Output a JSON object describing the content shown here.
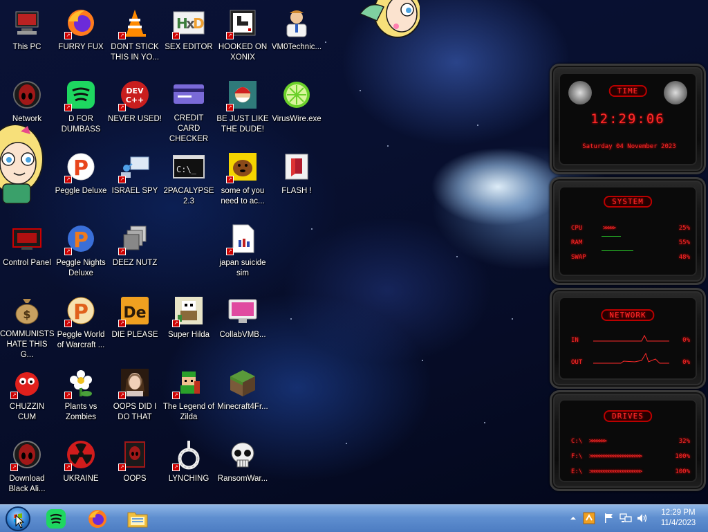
{
  "desktop": {
    "icons": [
      {
        "label": "This PC",
        "icon": "computer-icon"
      },
      {
        "label": "FURRY FUX",
        "icon": "firefox-icon"
      },
      {
        "label": "DONT STICK THIS IN YO...",
        "icon": "vlc-cone-icon"
      },
      {
        "label": "SEX EDITOR",
        "icon": "hex-editor-icon"
      },
      {
        "label": "HOOKED ON XONIX",
        "icon": "xonix-game-icon"
      },
      {
        "label": "VM0Technic...",
        "icon": "technician-icon"
      },
      {
        "label": "Network",
        "icon": "network-alien-icon"
      },
      {
        "label": "D FOR DUMBASS",
        "icon": "spotify-green-icon"
      },
      {
        "label": "NEVER USED!",
        "icon": "devcpp-icon"
      },
      {
        "label": "CREDIT CARD CHECKER",
        "icon": "credit-card-icon"
      },
      {
        "label": "BE JUST LIKE THE DUDE!",
        "icon": "santa-dude-icon"
      },
      {
        "label": "VirusWire.exe",
        "icon": "lime-icon"
      },
      {
        "label": "Peggle Deluxe",
        "icon": "peggle-icon"
      },
      {
        "label": "ISRAEL SPY",
        "icon": "remote-desktop-icon"
      },
      {
        "label": "2PACALYPSE 2.3",
        "icon": "cmd-terminal-icon"
      },
      {
        "label": "some of you need to ac...",
        "icon": "dog-icon"
      },
      {
        "label": "FLASH !",
        "icon": "flash-icon"
      },
      {
        "label": "Control Panel",
        "icon": "control-panel-icon"
      },
      {
        "label": "Peggle Nights Deluxe",
        "icon": "peggle-nights-icon"
      },
      {
        "label": "DEEZ NUTZ",
        "icon": "stacked-windows-icon"
      },
      {
        "label": "japan suicide sim",
        "icon": "document-icon"
      },
      {
        "label": "COMMUNISTS HATE THIS G...",
        "icon": "money-bag-icon"
      },
      {
        "label": "Peggle World of Warcraft ...",
        "icon": "peggle-wow-icon"
      },
      {
        "label": "DIE PLEASE",
        "icon": "de-icon"
      },
      {
        "label": "Super Hilda",
        "icon": "pixel-hilda-icon"
      },
      {
        "label": "CollabVMB...",
        "icon": "collabvm-monitor-icon"
      },
      {
        "label": "CHUZZIN CUM",
        "icon": "chuzzle-icon"
      },
      {
        "label": "Plants vs Zombies",
        "icon": "pvz-flower-icon"
      },
      {
        "label": "OOPS DID I DO THAT",
        "icon": "portrait-icon"
      },
      {
        "label": "The Legend of Zilda",
        "icon": "zilda-icon"
      },
      {
        "label": "Minecraft4Fr...",
        "icon": "minecraft-grass-icon"
      },
      {
        "label": "Download Black Ali...",
        "icon": "alien-head-icon"
      },
      {
        "label": "UKRAINE",
        "icon": "radiation-icon"
      },
      {
        "label": "OOPS",
        "icon": "oops-alien-icon"
      },
      {
        "label": "LYNCHING",
        "icon": "rope-icon"
      },
      {
        "label": "RansomWar...",
        "icon": "skull-icon"
      }
    ]
  },
  "widget": {
    "time": {
      "title": "TIME",
      "clock": "12:29:06",
      "date": "Saturday 04 November 2023"
    },
    "system": {
      "title": "SYSTEM",
      "rows": [
        {
          "label": "CPU",
          "value": "25%",
          "bar": ">>>>>"
        },
        {
          "label": "RAM",
          "value": "55%",
          "bar": ""
        },
        {
          "label": "SWAP",
          "value": "48%",
          "bar": ""
        }
      ]
    },
    "network": {
      "title": "NETWORK",
      "rows": [
        {
          "label": "IN",
          "value": "0%"
        },
        {
          "label": "OUT",
          "value": "0%"
        }
      ]
    },
    "drives": {
      "title": "DRIVES",
      "rows": [
        {
          "label": "C:\\",
          "value": "32%",
          "bar": ">>>>>>>"
        },
        {
          "label": "F:\\",
          "value": "100%",
          "bar": ">>>>>>>>>>>>>>>>>>>>>>"
        },
        {
          "label": "E:\\",
          "value": "100%",
          "bar": ">>>>>>>>>>>>>>>>>>>>>>"
        }
      ]
    }
  },
  "taskbar": {
    "pins": [
      {
        "name": "spotify",
        "icon": "spotify-icon"
      },
      {
        "name": "firefox",
        "icon": "firefox-icon"
      },
      {
        "name": "file-explorer",
        "icon": "folder-icon"
      }
    ],
    "tray": [
      "chevron-up-icon",
      "app-tray-icon",
      "flag-icon",
      "network-icon",
      "speaker-icon"
    ],
    "time": "12:29 PM",
    "date": "11/4/2023"
  },
  "colors": {
    "accent_red": "#ff2a2a",
    "taskbar_blue": "#5f8fd0",
    "wallpaper_dark": "#081030"
  }
}
